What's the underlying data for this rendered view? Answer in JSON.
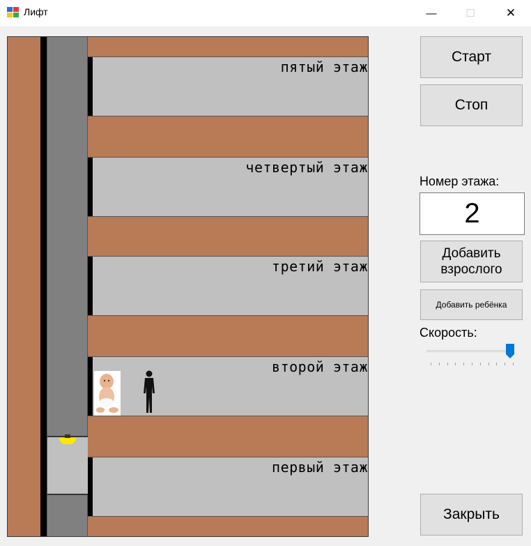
{
  "window": {
    "title": "Лифт",
    "minimize_icon": "minimize-icon",
    "maximize_icon": "maximize-icon",
    "close_icon": "close-icon",
    "minimize_glyph": "—",
    "maximize_glyph": "☐",
    "close_glyph": "✕"
  },
  "controls": {
    "start_label": "Старт",
    "stop_label": "Стоп",
    "floor_number_label": "Номер этажа:",
    "floor_number_value": "2",
    "add_adult_label": "Добавить взрослого",
    "add_child_label": "Добавить ребёнка",
    "speed_label": "Скорость:",
    "speed_level": 1.0,
    "speed_ticks": 11,
    "close_label": "Закрыть"
  },
  "building": {
    "floors": [
      {
        "label": "пятый этаж"
      },
      {
        "label": "четвертый этаж"
      },
      {
        "label": "третий этаж"
      },
      {
        "label": "второй этаж"
      },
      {
        "label": "первый этаж"
      }
    ],
    "elevator_floor": 1,
    "passengers_on_floor": "второй этаж",
    "passengers": [
      "baby-icon",
      "man-silhouette-icon"
    ]
  },
  "colors": {
    "wall": "#b97a56",
    "floor_room": "#c0c0c0",
    "shaft": "#808080",
    "lamp": "#ffe800",
    "slider_thumb": "#0078d7"
  }
}
